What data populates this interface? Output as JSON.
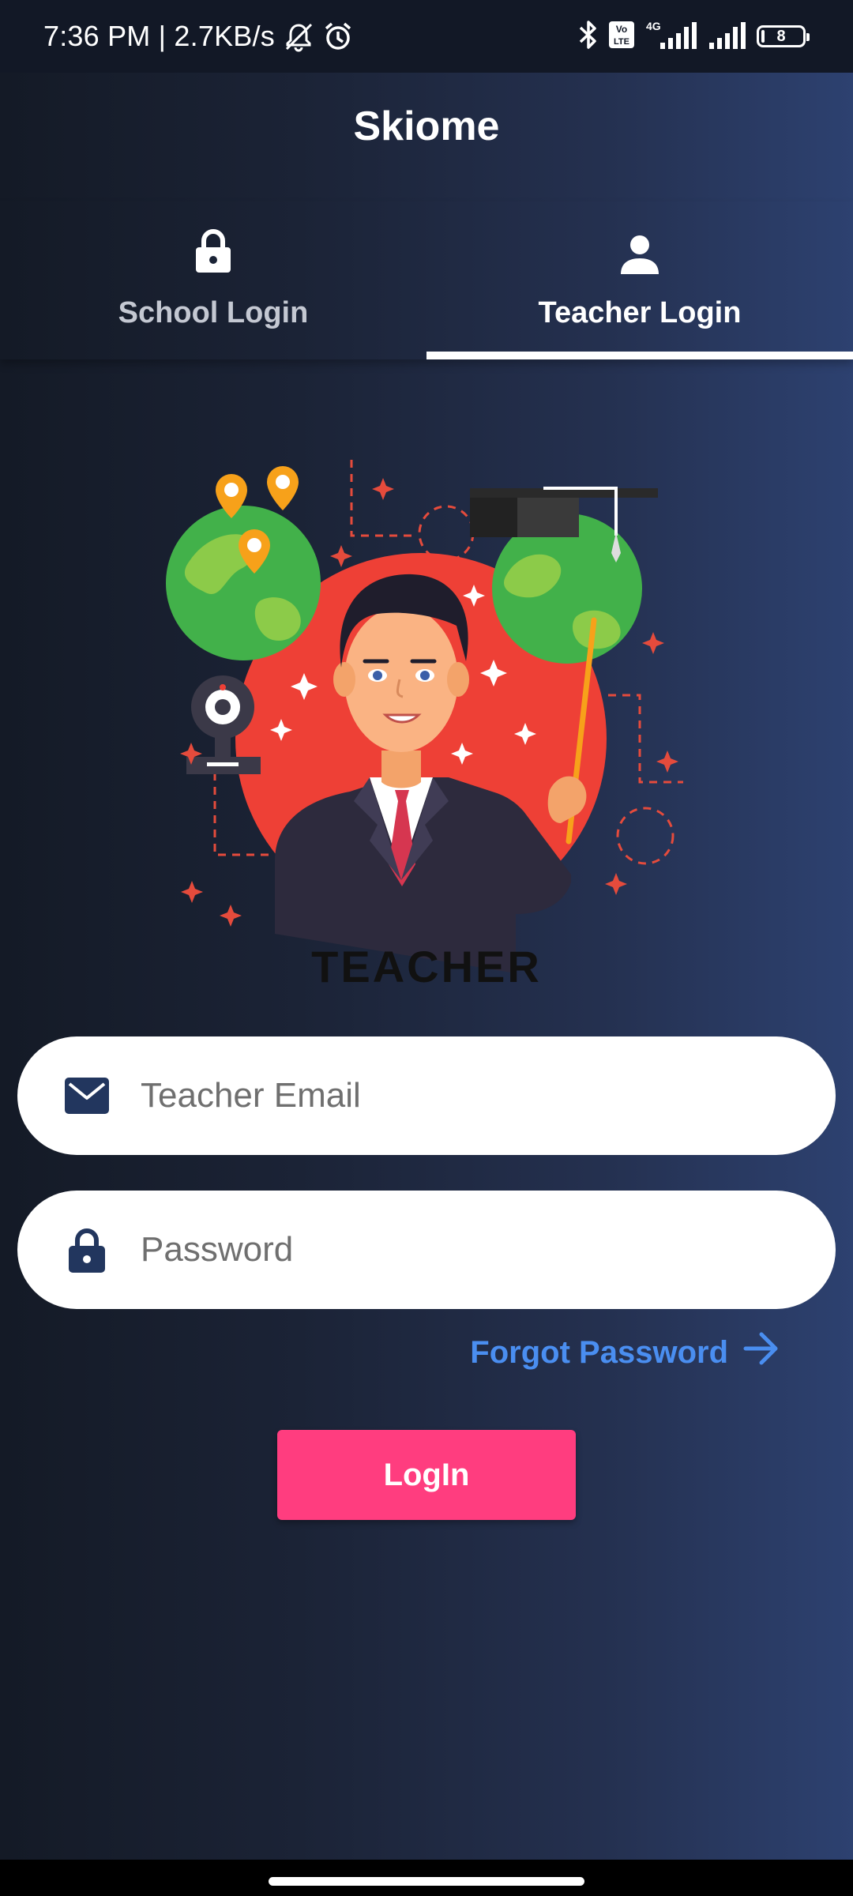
{
  "status_bar": {
    "time_speed": "7:36 PM | 2.7KB/s",
    "volte_label": "Vo LTE",
    "network_type": "4G",
    "battery_level": "8",
    "icons": [
      "mute-icon",
      "alarm-icon",
      "bluetooth-icon",
      "volte-icon",
      "signal-icon",
      "battery-icon"
    ]
  },
  "app": {
    "title": "Skiome"
  },
  "tabs": [
    {
      "label": "School Login",
      "icon": "lock-icon",
      "selected": false
    },
    {
      "label": "Teacher Login",
      "icon": "person-icon",
      "selected": true
    }
  ],
  "illustration": {
    "caption": "TEACHER"
  },
  "form": {
    "email_placeholder": "Teacher Email",
    "email_value": "",
    "password_placeholder": "Password",
    "password_value": "",
    "forgot_label": "Forgot Password",
    "login_label": "LogIn"
  },
  "colors": {
    "accent_pink": "#ff3d7f",
    "link_blue": "#4a8ef0",
    "field_icon_navy": "#22365e"
  }
}
